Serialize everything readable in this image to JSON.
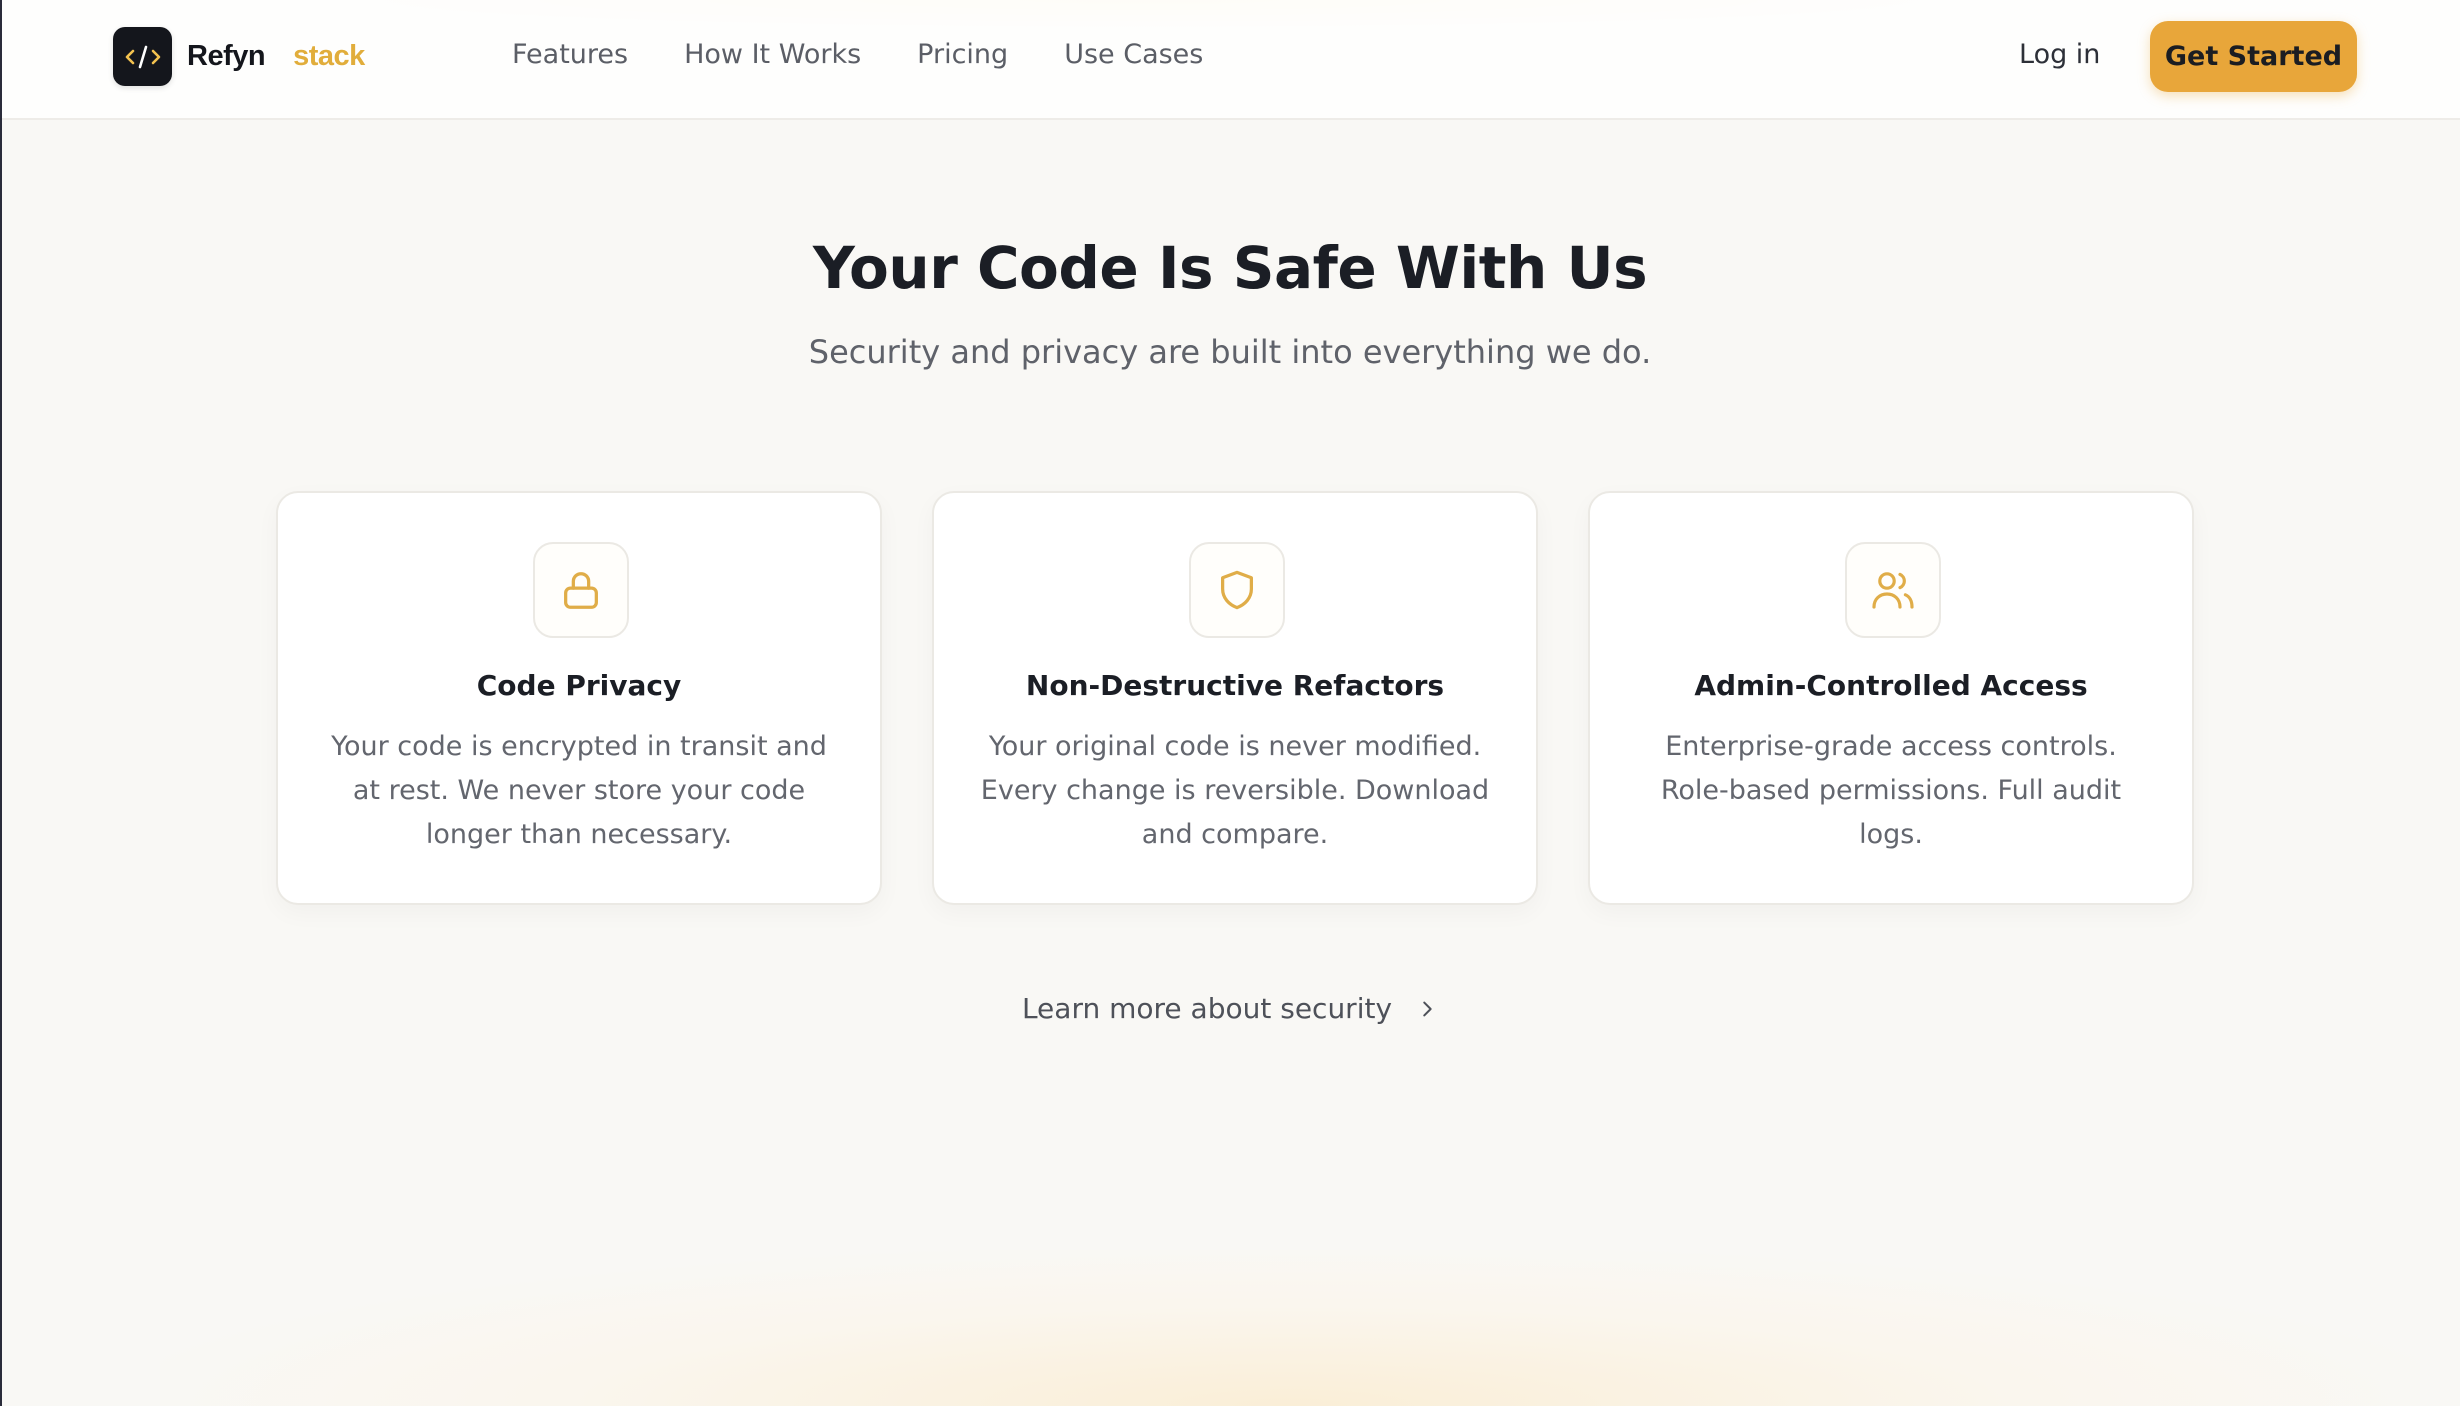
{
  "header": {
    "logo_word": "Refyn",
    "logo_suffix": "stack",
    "logo_mark": "</>",
    "nav": [
      "Features",
      "How It Works",
      "Pricing",
      "Use Cases"
    ],
    "login_label": "Log in",
    "cta_label": "Get Started"
  },
  "hero": {
    "title": "Your Code Is Safe With Us",
    "subtitle": "Security and privacy are built into everything we do."
  },
  "cards": [
    {
      "icon": "lock-icon",
      "title": "Code Privacy",
      "text": "Your code is encrypted in transit and at rest. We never store your code longer than necessary."
    },
    {
      "icon": "shield-icon",
      "title": "Non-Destructive Refactors",
      "text": "Your original code is never modified. Every change is reversible. Download and compare."
    },
    {
      "icon": "users-icon",
      "title": "Admin-Controlled Access",
      "text": "Enterprise-grade access controls. Role-based permissions. Full audit logs."
    }
  ],
  "learn_more": "Learn more about security",
  "colors": {
    "accent": "#e8a63a",
    "brand_suffix": "#e1ad3b",
    "icon": "#e0ad48",
    "text_dark": "#1b1e25",
    "text_muted": "#63666e",
    "background": "#f9f8f5"
  }
}
